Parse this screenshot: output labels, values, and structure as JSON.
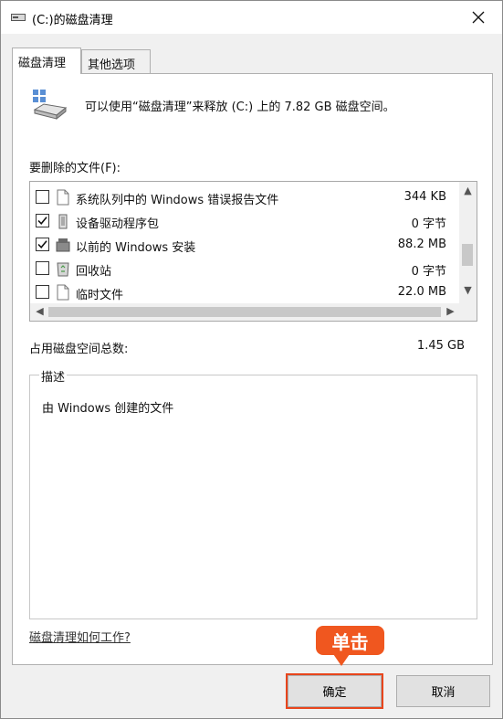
{
  "window": {
    "title": "(C:)的磁盘清理",
    "icon": "disk-drive-icon",
    "close_icon": "close-icon"
  },
  "tabs": [
    {
      "label": "磁盘清理",
      "active": true
    },
    {
      "label": "其他选项",
      "active": false
    }
  ],
  "main": {
    "intro_text": "可以使用“磁盘清理”来释放 (C:) 上的 7.82 GB 磁盘空间。",
    "files_label": "要删除的文件(F):",
    "files": [
      {
        "name": "系统队列中的 Windows 错误报告文件",
        "size": "344 KB",
        "checked": false,
        "icon": "document-icon"
      },
      {
        "name": "设备驱动程序包",
        "size": "0 字节",
        "checked": true,
        "icon": "driver-package-icon"
      },
      {
        "name": "以前的 Windows 安装",
        "size": "88.2 MB",
        "checked": true,
        "icon": "windows-installation-icon"
      },
      {
        "name": "回收站",
        "size": "0 字节",
        "checked": false,
        "icon": "recycle-bin-icon"
      },
      {
        "name": "临时文件",
        "size": "22.0 MB",
        "checked": false,
        "icon": "document-icon"
      }
    ],
    "total_label": "占用磁盘空间总数:",
    "total_value": "1.45 GB",
    "description_legend": "描述",
    "description_text": "由 Windows 创建的文件",
    "help_link": "磁盘清理如何工作?"
  },
  "buttons": {
    "ok_label": "确定",
    "cancel_label": "取消"
  },
  "annotation": {
    "callout_text": "单击",
    "color": "#f0571f"
  }
}
